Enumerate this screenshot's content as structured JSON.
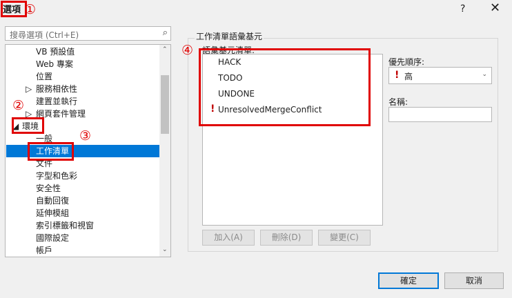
{
  "window": {
    "title": "選項",
    "help": "?",
    "close": "✕"
  },
  "markers": {
    "m1": "①",
    "m2": "②",
    "m3": "③",
    "m4": "④"
  },
  "search": {
    "placeholder": "搜尋選項 (Ctrl+E)",
    "icon": "search-icon"
  },
  "tree": {
    "items": [
      {
        "label": "VB 預設值"
      },
      {
        "label": "Web 專案"
      },
      {
        "label": "位置"
      },
      {
        "label": "服務相依性"
      },
      {
        "label": "建置並執行"
      },
      {
        "label": "網頁套件管理"
      },
      {
        "label": "環境"
      },
      {
        "label": "一般"
      },
      {
        "label": "工作清單"
      },
      {
        "label": "文件"
      },
      {
        "label": "字型和色彩"
      },
      {
        "label": "安全性"
      },
      {
        "label": "自動回復"
      },
      {
        "label": "延伸模組"
      },
      {
        "label": "索引標籤和視窗"
      },
      {
        "label": "國際設定"
      },
      {
        "label": "帳戶"
      }
    ],
    "expand_arrow": "▷",
    "collapse_arrow": "◢",
    "scroll_up": "⌃",
    "scroll_down": "⌄"
  },
  "panel": {
    "group_title": "工作清單語彙基元",
    "list_label": "語彙基元清單:",
    "tokens": [
      {
        "label": "HACK"
      },
      {
        "label": "TODO"
      },
      {
        "label": "UNDONE"
      },
      {
        "label": "UnresolvedMergeConflict"
      }
    ],
    "warn_icon": "!",
    "buttons": {
      "add": "加入(A)",
      "delete": "刪除(D)",
      "change": "變更(C)"
    },
    "priority_label": "優先順序:",
    "priority_value": "高",
    "priority_chevron": "⌄",
    "name_label": "名稱:"
  },
  "footer": {
    "ok": "確定",
    "cancel": "取消"
  },
  "colors": {
    "accent": "#0078d7",
    "annotation": "#e00000",
    "priority_high": "#c00000"
  }
}
